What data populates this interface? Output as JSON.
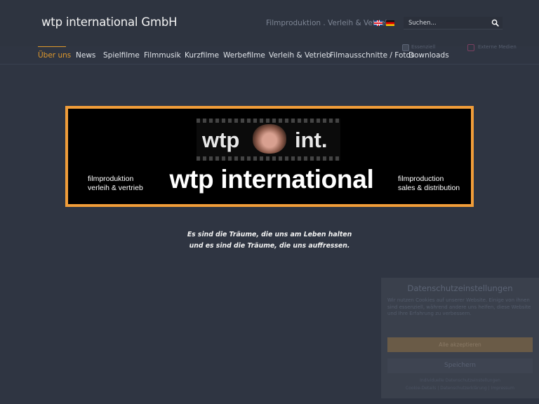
{
  "header": {
    "site_title": "wtp international GmbH",
    "tagline": "Filmproduktion . Verleih & Vetrieb",
    "languages": [
      {
        "code": "en",
        "icon": "uk-flag-icon"
      },
      {
        "code": "de",
        "icon": "german-flag-icon"
      }
    ],
    "search": {
      "placeholder": "Suchen..."
    }
  },
  "nav": {
    "items": [
      {
        "label": "Über uns",
        "active": true
      },
      {
        "label": "News"
      },
      {
        "label": "Spielfilme"
      },
      {
        "label": "Filmmusik"
      },
      {
        "label": "Kurzfilme"
      },
      {
        "label": "Werbefilme"
      },
      {
        "label": "Verleih & Vetrieb"
      },
      {
        "label": "Filmausschnitte / Fotos"
      },
      {
        "label": "Downloads"
      }
    ]
  },
  "banner": {
    "logo_left": "wtp",
    "logo_right": "int.",
    "title": "wtp international",
    "left_line1": "filmproduktion",
    "left_line2": "verleih & vertrieb",
    "right_line1": "filmproduction",
    "right_line2": "sales & distribution"
  },
  "quote": {
    "line1": "Es sind die Träume, die uns am Leben halten",
    "line2": "und es sind die Träume, die uns auffressen."
  },
  "cookie": {
    "title": "Datenschutzeinstellungen",
    "text": "Wir nutzen Cookies auf unserer Website. Einige von ihnen sind essenziell, während andere uns helfen, diese Website und Ihre Erfahrung zu verbessern.",
    "essential_label": "Essenziell",
    "external_label": "Externe Medien",
    "accept_label": "Alle akzeptieren",
    "save_label": "Speichern",
    "individual_link": "Individuelle Datenschutzeinstellungen",
    "links": "Cookie-Details | Datenschutzerklärung | Impressum"
  },
  "colors": {
    "accent": "#e0992c",
    "banner_border": "#f19d39",
    "background": "#2f3542"
  }
}
